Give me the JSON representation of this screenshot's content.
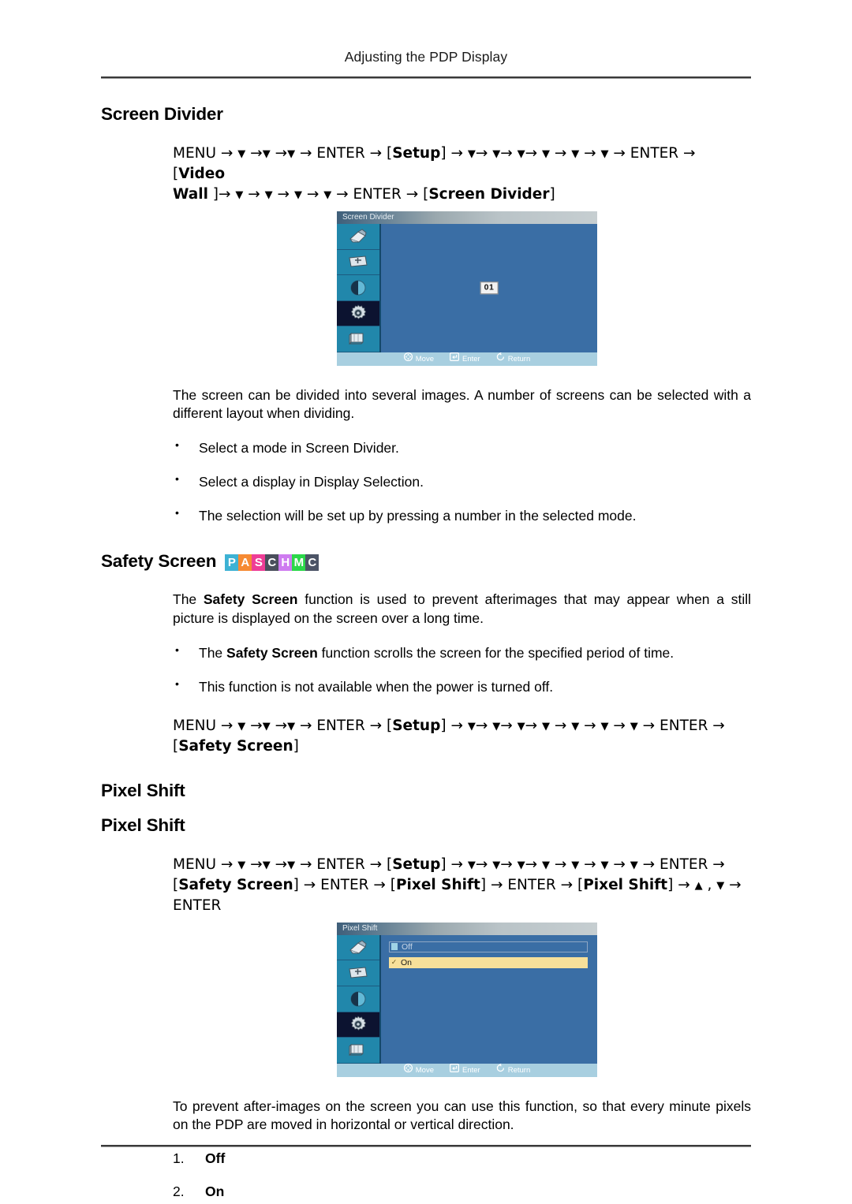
{
  "header": {
    "running_title": "Adjusting the PDP Display"
  },
  "sections": {
    "screen_divider": {
      "heading": "Screen Divider",
      "menu_path_line1_pre": "MENU ",
      "menu_path_line1": "MENU → ▼ →▼ →▼ → ENTER → [Setup] → ▼→ ▼→ ▼→ ▼ → ▼ → ▼ → ENTER → [Video",
      "menu_path_line2": "Wall ]→ ▼ → ▼ → ▼ → ▼ → ENTER → [Screen Divider]",
      "bold_tokens": [
        "Setup",
        "Video",
        "Wall",
        "Screen Divider"
      ],
      "paragraph": "The screen can be divided into several images. A number of screens can be selected with a different layout when dividing.",
      "bullets": [
        "Select a mode in Screen Divider.",
        "Select a display in Display Selection.",
        "The selection will be set up by pressing a number in the selected mode."
      ],
      "osd": {
        "title": "Screen Divider",
        "chip_value": "01",
        "footer": [
          {
            "icon": "dpad-icon",
            "label": "Move"
          },
          {
            "icon": "enter-key-icon",
            "label": "Enter"
          },
          {
            "icon": "return-arrow-icon",
            "label": "Return"
          }
        ],
        "rail_icons": [
          {
            "name": "picture-icon",
            "selected": false
          },
          {
            "name": "screen-adjust-icon",
            "selected": false
          },
          {
            "name": "contrast-icon",
            "selected": false
          },
          {
            "name": "setup-gear-icon",
            "selected": true
          },
          {
            "name": "multi-display-icon",
            "selected": false
          }
        ]
      }
    },
    "safety_screen": {
      "heading": "Safety Screen",
      "badges": [
        {
          "letter": "P",
          "color": "#3DB2D4"
        },
        {
          "letter": "A",
          "color": "#F68A33"
        },
        {
          "letter": "S",
          "color": "#EE3D96"
        },
        {
          "letter": "C",
          "color": "#4A4F5C"
        },
        {
          "letter": "H",
          "color": "#CE7BF0"
        },
        {
          "letter": "M",
          "color": "#2CD84A"
        },
        {
          "letter": "C",
          "color": "#4C5466"
        }
      ],
      "paragraph": "The Safety Screen function is used to prevent afterimages that may appear when a still picture is displayed on the screen over a long time.",
      "bullets": [
        "The Safety Screen function scrolls the screen for the specified period of time.",
        "This function is not available when the power is turned off."
      ],
      "menu_path_line1": "MENU → ▼ →▼ →▼ → ENTER → [Setup] → ▼→ ▼→ ▼→ ▼ → ▼ → ▼ → ▼ → ENTER →",
      "menu_path_line2": "[Safety Screen]"
    },
    "pixel_shift": {
      "heading_1": "Pixel Shift",
      "heading_2": "Pixel Shift",
      "menu_path_line1": "MENU → ▼ →▼ →▼ → ENTER → [Setup] → ▼→ ▼→ ▼→ ▼ → ▼ → ▼ → ▼ → ENTER →",
      "menu_path_line2": "[Safety Screen] → ENTER → [Pixel Shift] → ENTER → [Pixel Shift] → ▲ , ▼ → ENTER",
      "osd": {
        "title": "Pixel Shift",
        "options": [
          {
            "label": "Off",
            "state": "unselected"
          },
          {
            "label": "On",
            "state": "selected"
          }
        ],
        "footer": [
          {
            "icon": "dpad-icon",
            "label": "Move"
          },
          {
            "icon": "enter-key-icon",
            "label": "Enter"
          },
          {
            "icon": "return-arrow-icon",
            "label": "Return"
          }
        ],
        "rail_icons": [
          {
            "name": "picture-icon",
            "selected": false
          },
          {
            "name": "screen-adjust-icon",
            "selected": false
          },
          {
            "name": "contrast-icon",
            "selected": false
          },
          {
            "name": "setup-gear-icon",
            "selected": true
          },
          {
            "name": "multi-display-icon",
            "selected": false
          }
        ]
      },
      "paragraph": "To prevent after-images on the screen you can use this function, so that every minute pixels on the PDP are moved in horizontal or vertical direction.",
      "numbered": [
        {
          "num": "1.",
          "label": "Off"
        },
        {
          "num": "2.",
          "label": "On"
        }
      ]
    }
  }
}
